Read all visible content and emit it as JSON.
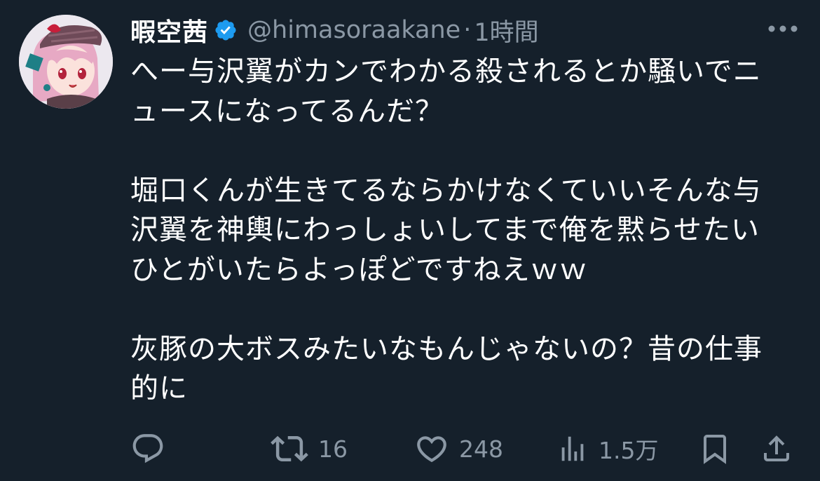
{
  "author": {
    "display_name": "暇空茜",
    "handle": "@himasoraakane",
    "separator": "·",
    "time": "1時間",
    "verified": true,
    "avatar_icon": "anime-character-avatar"
  },
  "tweet": {
    "text": "へー与沢翼がカンでわかる殺されるとか騒いでニュースになってるんだ？\n\n堀口くんが生きてるならかけなくていいそんな与沢翼を神輿にわっしょいしてまで俺を黙らせたいひとがいたらよっぽどですねえｗｗ\n\n灰豚の大ボスみたいなもんじゃないの？昔の仕事的に"
  },
  "actions": {
    "reply": {
      "icon": "reply-icon",
      "count": ""
    },
    "retweet": {
      "icon": "retweet-icon",
      "count": "16"
    },
    "like": {
      "icon": "heart-icon",
      "count": "248"
    },
    "views": {
      "icon": "views-icon",
      "count": "1.5万"
    },
    "bookmark": {
      "icon": "bookmark-icon"
    },
    "share": {
      "icon": "share-icon"
    }
  },
  "colors": {
    "background": "#15202b",
    "primary_text": "#ffffff",
    "secondary_text": "#8b98a5",
    "verified_badge": "#1d9bf0"
  }
}
